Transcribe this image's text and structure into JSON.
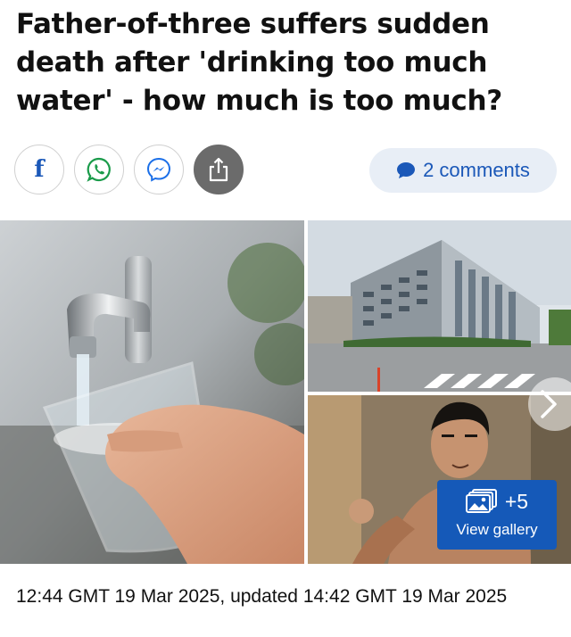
{
  "article": {
    "headline": "Father-of-three suffers sudden death after 'drinking too much water' - how much is too much?",
    "timestamp": "12:44 GMT 19 Mar 2025, updated 14:42 GMT 19 Mar 2025"
  },
  "share": {
    "facebook_icon": "facebook-icon",
    "whatsapp_icon": "whatsapp-icon",
    "messenger_icon": "messenger-icon",
    "share_icon": "share-icon",
    "facebook_glyph": "f"
  },
  "comments": {
    "label": "2 comments",
    "icon": "speech-bubble-icon"
  },
  "gallery": {
    "extra_count": "+5",
    "view_label": "View gallery",
    "images": [
      "glass being filled with tap water",
      "hospital building exterior",
      "martial artist in fighting stance"
    ],
    "next_icon": "chevron-right-icon"
  },
  "colors": {
    "brand_blue": "#1b58b8",
    "pill_bg": "#e8eef6",
    "gallery_button": "#1559b8",
    "share_dark": "#6b6b6b"
  }
}
